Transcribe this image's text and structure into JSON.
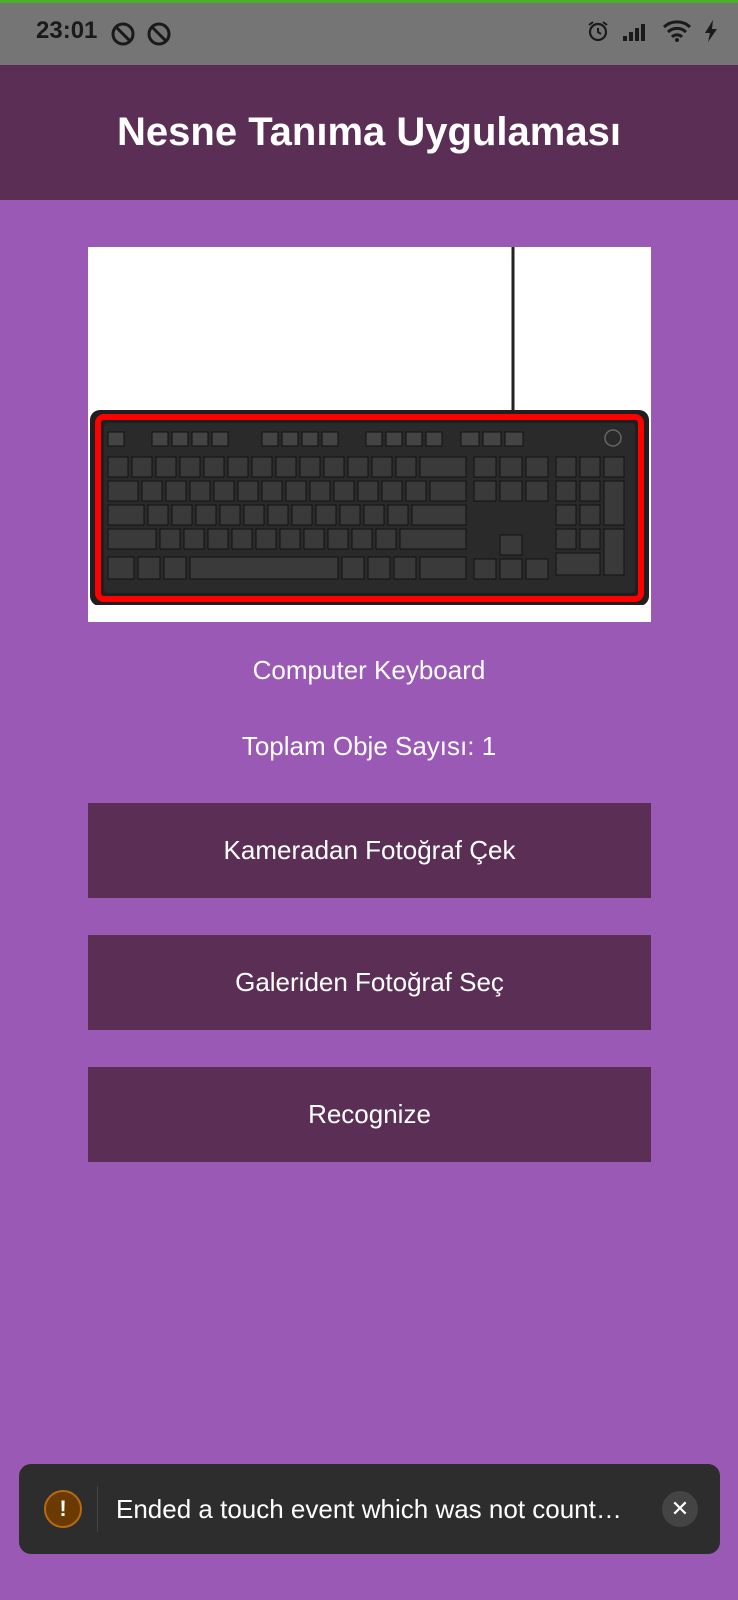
{
  "status_bar": {
    "time": "23:01",
    "left_icons": [
      "notification-icon",
      "notification-icon"
    ],
    "right_icons": [
      "alarm-icon",
      "signal-icon",
      "wifi-icon",
      "charging-icon"
    ]
  },
  "app_bar": {
    "title": "Nesne Tanıma Uygulaması"
  },
  "image_preview": {
    "subject_icon": "keyboard-image",
    "highlight_color": "#ff0000"
  },
  "result": {
    "label": "Computer Keyboard",
    "count_text": "Toplam Obje Sayısı: 1"
  },
  "buttons": {
    "camera": "Kameradan Fotoğraf Çek",
    "gallery": "Galeriden Fotoğraf Seç",
    "recognize": "Recognize"
  },
  "toast": {
    "icon": "warning-icon",
    "message": "Ended a touch event which was not count…",
    "close_icon": "close-icon"
  },
  "colors": {
    "background": "#9b59b6",
    "app_bar": "#5b2f55",
    "button": "#5b2f55",
    "status_bar": "#757575"
  }
}
